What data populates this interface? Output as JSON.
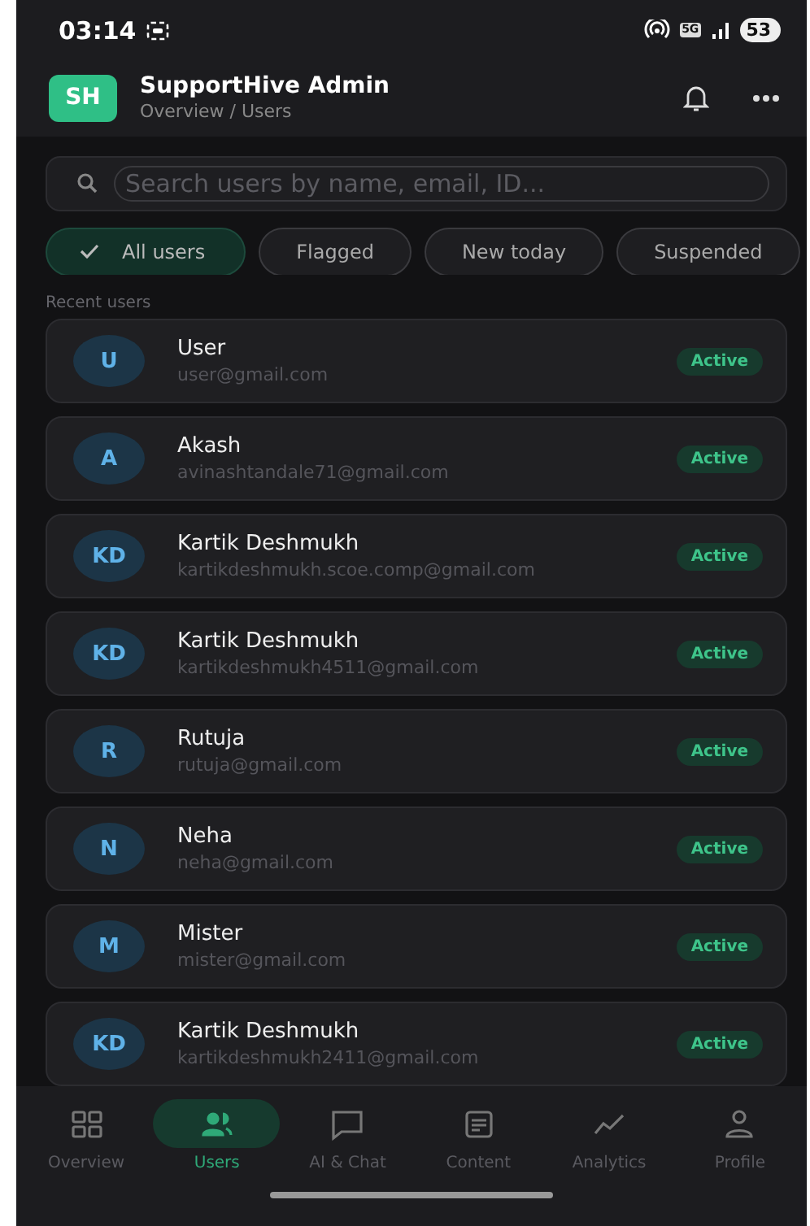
{
  "status_bar": {
    "time": "03:14",
    "network": "5G",
    "battery": "53"
  },
  "header": {
    "avatar": "SH",
    "title": "SupportHive Admin",
    "breadcrumb": "Overview / Users"
  },
  "search": {
    "placeholder": "Search users by name, email, ID..."
  },
  "filters": [
    {
      "label": "All users",
      "selected": true
    },
    {
      "label": "Flagged",
      "selected": false
    },
    {
      "label": "New today",
      "selected": false
    },
    {
      "label": "Suspended",
      "selected": false
    }
  ],
  "section_title": "Recent users",
  "users": [
    {
      "initials": "U",
      "name": "User",
      "email": "user@gmail.com",
      "status": "Active"
    },
    {
      "initials": "A",
      "name": "Akash",
      "email": "avinashtandale71@gmail.com",
      "status": "Active"
    },
    {
      "initials": "KD",
      "name": "Kartik Deshmukh",
      "email": "kartikdeshmukh.scoe.comp@gmail.com",
      "status": "Active"
    },
    {
      "initials": "KD",
      "name": "Kartik Deshmukh",
      "email": "kartikdeshmukh4511@gmail.com",
      "status": "Active"
    },
    {
      "initials": "R",
      "name": "Rutuja",
      "email": "rutuja@gmail.com",
      "status": "Active"
    },
    {
      "initials": "N",
      "name": "Neha",
      "email": "neha@gmail.com",
      "status": "Active"
    },
    {
      "initials": "M",
      "name": "Mister",
      "email": "mister@gmail.com",
      "status": "Active"
    },
    {
      "initials": "KD",
      "name": "Kartik Deshmukh",
      "email": "kartikdeshmukh2411@gmail.com",
      "status": "Active"
    }
  ],
  "nav": [
    {
      "kind": "grid",
      "label": "Overview",
      "selected": false
    },
    {
      "kind": "users",
      "label": "Users",
      "selected": true
    },
    {
      "kind": "chat",
      "label": "AI & Chat",
      "selected": false
    },
    {
      "kind": "doc",
      "label": "Content",
      "selected": false
    },
    {
      "kind": "trend",
      "label": "Analytics",
      "selected": false
    },
    {
      "kind": "person",
      "label": "Profile",
      "selected": false
    }
  ]
}
